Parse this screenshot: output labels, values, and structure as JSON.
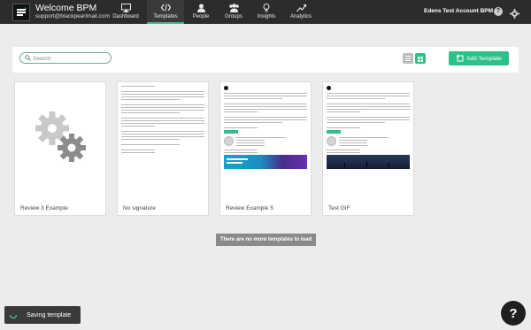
{
  "header": {
    "title": "Welcome BPM",
    "email": "support@blackpearlmail.com",
    "logo_icon": "black-pearl-logo-icon",
    "nav": [
      {
        "label": "Dashboard",
        "icon": "monitor-icon",
        "active": false
      },
      {
        "label": "Templates",
        "icon": "code-icon",
        "active": true
      },
      {
        "label": "People",
        "icon": "person-icon",
        "active": false
      },
      {
        "label": "Groups",
        "icon": "group-icon",
        "active": false
      },
      {
        "label": "Insights",
        "icon": "lightbulb-icon",
        "active": false
      },
      {
        "label": "Analytics",
        "icon": "trend-chart-icon",
        "active": false
      }
    ],
    "account": "Edens Test Account BPM",
    "help_glyph": "?",
    "accent": "#2fbf8a"
  },
  "toolbar": {
    "search_placeholder": "Search",
    "search_value": "",
    "add_label": "Add Template"
  },
  "templates": [
    {
      "name": "Review 3 Example",
      "preview": "placeholder-gears"
    },
    {
      "name": "No signature",
      "preview": "text-email"
    },
    {
      "name": "Review Example 5",
      "preview": "email-with-banner"
    },
    {
      "name": "Test GIF",
      "preview": "email-with-dark-banner"
    }
  ],
  "status": {
    "no_more": "There are no more templates to load",
    "saving": "Saving template"
  },
  "help_fab": "?"
}
